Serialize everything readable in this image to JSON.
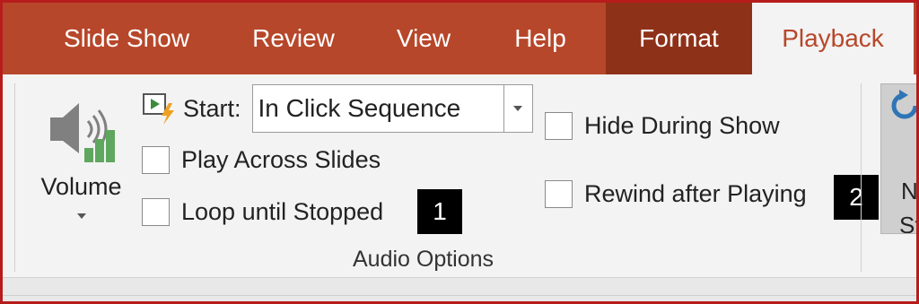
{
  "tabs": [
    {
      "label": "Slide Show"
    },
    {
      "label": "Review"
    },
    {
      "label": "View"
    },
    {
      "label": "Help"
    },
    {
      "label": "Format"
    },
    {
      "label": "Playback"
    }
  ],
  "active_tab": "Playback",
  "colors": {
    "tab_bar": "#b7472a",
    "format_tab": "#8e3119",
    "ribbon": "#f3f3f3",
    "active_text": "#b7472a",
    "frame_border": "#b71c1c"
  },
  "volume": {
    "label": "Volume",
    "icon": "speaker-volume-icon"
  },
  "start": {
    "label": "Start:",
    "icon": "play-start-icon",
    "value": "In Click Sequence"
  },
  "checkboxes": {
    "play_across_slides": {
      "label": "Play Across Slides",
      "checked": false
    },
    "loop_until_stopped": {
      "label": "Loop until Stopped",
      "checked": false
    },
    "hide_during_show": {
      "label": "Hide During Show",
      "checked": false
    },
    "rewind_after_playing": {
      "label": "Rewind after Playing",
      "checked": false
    }
  },
  "group_label": "Audio Options",
  "callouts": [
    "1",
    "2"
  ],
  "partial_button": {
    "text_line1": "N",
    "text_line2": "St"
  }
}
